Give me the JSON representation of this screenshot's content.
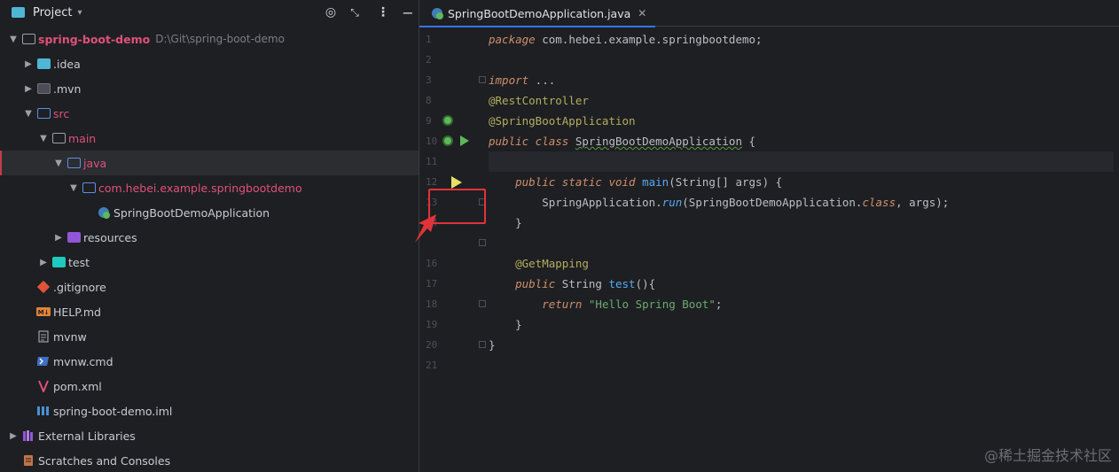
{
  "panel": {
    "title": "Project",
    "buttons": [
      "locate-icon",
      "collapse-icon",
      "options-icon",
      "hide-icon"
    ]
  },
  "tree": [
    {
      "label": "spring-boot-demo",
      "path": "D:\\Git\\spring-boot-demo",
      "icon": "module-folder-icon"
    },
    {
      "label": ".idea",
      "icon": "folder-icon"
    },
    {
      "label": ".mvn",
      "icon": "folder-icon"
    },
    {
      "label": "src",
      "icon": "source-folder-icon"
    },
    {
      "label": "main",
      "icon": "folder-icon"
    },
    {
      "label": "java",
      "icon": "folder-icon"
    },
    {
      "label": "com.hebei.example.springbootdemo",
      "icon": "package-icon"
    },
    {
      "label": "SpringBootDemoApplication",
      "icon": "spring-class-icon"
    },
    {
      "label": "resources",
      "icon": "resources-folder-icon"
    },
    {
      "label": "test",
      "icon": "test-folder-icon"
    },
    {
      "label": ".gitignore",
      "icon": "git-icon"
    },
    {
      "label": "HELP.md",
      "icon": "markdown-icon"
    },
    {
      "label": "mvnw",
      "icon": "text-file-icon"
    },
    {
      "label": "mvnw.cmd",
      "icon": "powershell-icon"
    },
    {
      "label": "pom.xml",
      "icon": "maven-icon"
    },
    {
      "label": "spring-boot-demo.iml",
      "icon": "iml-icon"
    },
    {
      "label": "External Libraries",
      "icon": "library-icon"
    },
    {
      "label": "Scratches and Consoles",
      "icon": "scratches-icon"
    }
  ],
  "editor": {
    "tab_label": "SpringBootDemoApplication.java",
    "line_numbers": [
      "1",
      "2",
      "3",
      "8",
      "9",
      "10",
      "11",
      "12",
      "13",
      "14",
      "16",
      "17",
      "18",
      "19",
      "20",
      "21"
    ]
  },
  "code": {
    "l1": {
      "kw": "package",
      "rest": " com.hebei.example.springbootdemo;"
    },
    "l3": {
      "kw": "import",
      "rest": " ..."
    },
    "l8": "@RestController",
    "l9": "@SpringBootApplication",
    "l10": {
      "kw": "public class",
      "cls": "SpringBootDemoApplication",
      "rest": " {"
    },
    "l12": {
      "kw": "public static void",
      "fn": "main",
      "rest": "(String[] args) {"
    },
    "l13": {
      "cls": "SpringApplication.",
      "fn": "run",
      "mid": "(SpringBootDemoApplication.",
      "kw": "class",
      "rest": ", args);"
    },
    "l14": "}",
    "l16": "@GetMapping",
    "l17": {
      "kw": "public",
      "type": " String ",
      "fn": "test",
      "rest": "(){"
    },
    "l18": {
      "kw": "return",
      "str": "\"Hello Spring Boot\"",
      "rest": ";"
    },
    "l19": "}",
    "l20": "}"
  },
  "watermark": "@稀土掘金技术社区"
}
